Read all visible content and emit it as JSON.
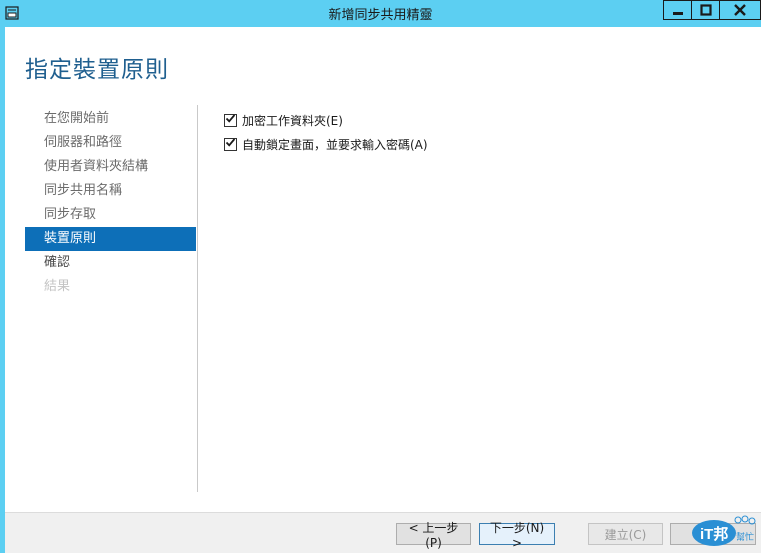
{
  "window": {
    "title": "新增同步共用精靈",
    "buttons": {
      "minimize": "minimize",
      "maximize": "maximize",
      "close": "close"
    }
  },
  "page": {
    "title": "指定裝置原則"
  },
  "nav": {
    "items": [
      {
        "label": "在您開始前",
        "state": "normal"
      },
      {
        "label": "伺服器和路徑",
        "state": "normal"
      },
      {
        "label": "使用者資料夾結構",
        "state": "normal"
      },
      {
        "label": "同步共用名稱",
        "state": "normal"
      },
      {
        "label": "同步存取",
        "state": "normal"
      },
      {
        "label": "裝置原則",
        "state": "selected"
      },
      {
        "label": "確認",
        "state": "normal"
      },
      {
        "label": "結果",
        "state": "disabled"
      }
    ]
  },
  "options": [
    {
      "label": "加密工作資料夾(E)",
      "checked": true
    },
    {
      "label": "自動鎖定畫面，並要求輸入密碼(A)",
      "checked": true
    }
  ],
  "footer": {
    "prev_label": "< 上一步(P)",
    "next_label": "下一步(N) >",
    "create_label": "建立(C)",
    "cancel_label": ""
  },
  "watermark": {
    "brand": "iT邦",
    "tag": "幫忙"
  },
  "colors": {
    "titlebar": "#5ccff2",
    "accent": "#0d6fb8",
    "page_title": "#1f5f8f"
  }
}
